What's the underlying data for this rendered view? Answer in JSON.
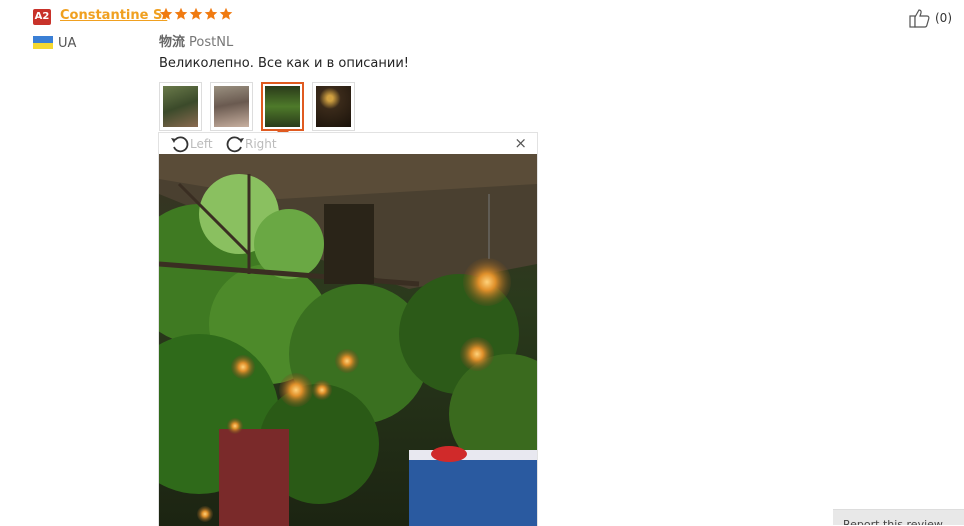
{
  "reviewer": {
    "badge": "A2",
    "name": "Constantine S.",
    "country": "UA"
  },
  "review": {
    "rating": 5,
    "logistics_label": "物流",
    "logistics_value": "PostNL",
    "text": "Великолепно. Все как и в описании!"
  },
  "thumbnails": [
    {
      "name": "photo-1",
      "active": false
    },
    {
      "name": "photo-2",
      "active": false
    },
    {
      "name": "photo-3",
      "active": true
    },
    {
      "name": "photo-4",
      "active": false
    }
  ],
  "viewer": {
    "rotate_left_label": "Left",
    "rotate_right_label": "Right",
    "close_symbol": "×"
  },
  "helpful": {
    "count": "(0)"
  },
  "corner_button": {
    "label": "Report this review"
  },
  "colors": {
    "accent": "#e05a20",
    "username": "#f0a020",
    "star": "#f07a10",
    "badge": "#c8322a"
  },
  "icons": [
    "star-icon",
    "flag-ua-icon",
    "rotate-left-icon",
    "rotate-right-icon",
    "close-icon",
    "thumbs-up-icon"
  ]
}
